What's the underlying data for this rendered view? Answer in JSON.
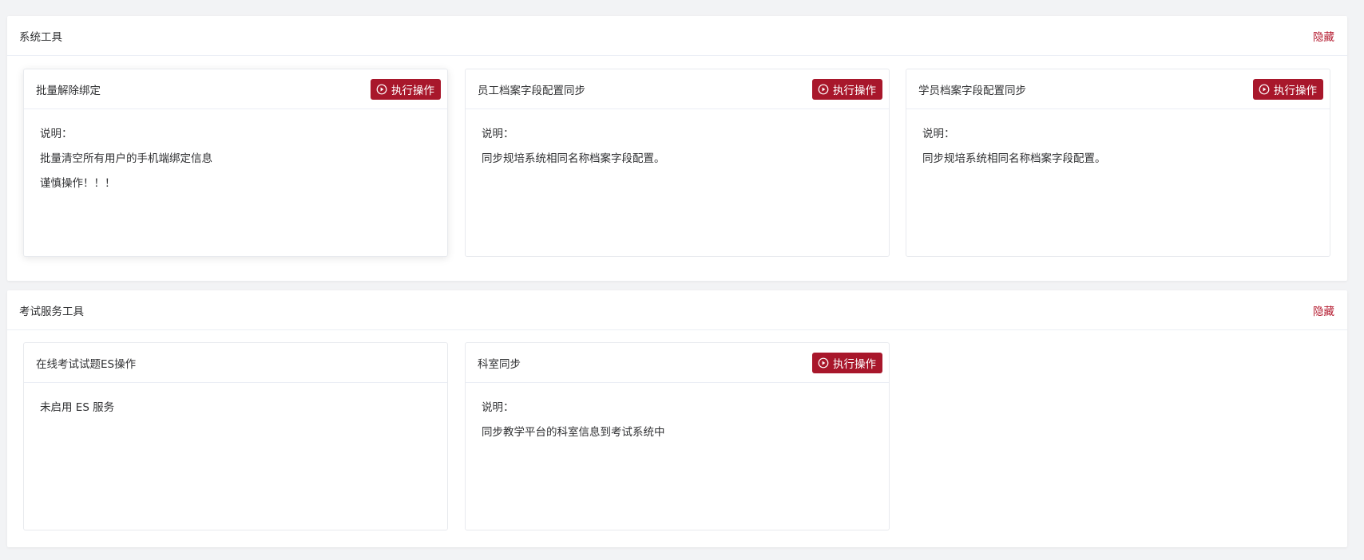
{
  "sections": [
    {
      "title": "系统工具",
      "hide_label": "隐藏",
      "cards": [
        {
          "title": "批量解除绑定",
          "button_label": "执行操作",
          "lines": [
            "说明：",
            "批量清空所有用户的手机端绑定信息",
            "谨慎操作！！！"
          ]
        },
        {
          "title": "员工档案字段配置同步",
          "button_label": "执行操作",
          "lines": [
            "说明：",
            "同步规培系统相同名称档案字段配置。"
          ]
        },
        {
          "title": "学员档案字段配置同步",
          "button_label": "执行操作",
          "lines": [
            "说明：",
            "同步规培系统相同名称档案字段配置。"
          ]
        }
      ]
    },
    {
      "title": "考试服务工具",
      "hide_label": "隐藏",
      "cards": [
        {
          "title": "在线考试试题ES操作",
          "lines": [
            "未启用 ES 服务"
          ]
        },
        {
          "title": "科室同步",
          "button_label": "执行操作",
          "lines": [
            "说明：",
            "同步教学平台的科室信息到考试系统中"
          ]
        }
      ]
    }
  ],
  "colors": {
    "accent": "#a8172b",
    "hide_link": "#b3172c",
    "background": "#f2f3f5"
  },
  "icons": {
    "execute": "play-circle-icon"
  }
}
